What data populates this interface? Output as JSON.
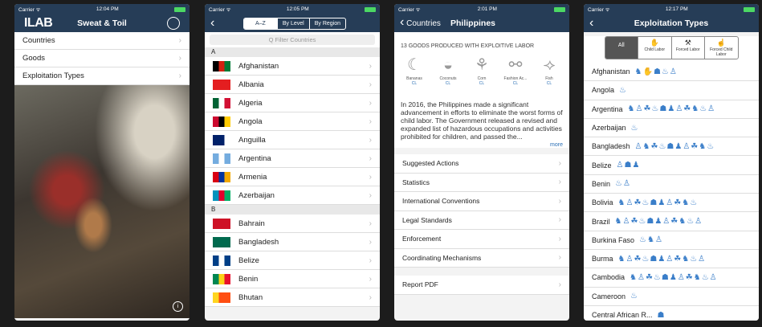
{
  "phone1": {
    "status": {
      "carrier": "Carrier ᯤ",
      "time": "12:04 PM"
    },
    "logo": "ILAB",
    "title": "Sweat & Toil",
    "menu": [
      {
        "label": "Countries"
      },
      {
        "label": "Goods"
      },
      {
        "label": "Exploitation Types"
      }
    ]
  },
  "phone2": {
    "status": {
      "carrier": "Carrier ᯤ",
      "time": "12:05 PM"
    },
    "segments": [
      "A–Z",
      "By Level",
      "By Region"
    ],
    "search_placeholder": "Q  Filter Countries",
    "section_a": "A",
    "section_b": "B",
    "countries_a": [
      {
        "name": "Afghanistan",
        "flag": [
          "#000000",
          "#d32011",
          "#007a36"
        ]
      },
      {
        "name": "Albania",
        "flag": [
          "#e41e20",
          "#e41e20",
          "#e41e20"
        ]
      },
      {
        "name": "Algeria",
        "flag": [
          "#006233",
          "#ffffff",
          "#d21034"
        ]
      },
      {
        "name": "Angola",
        "flag": [
          "#cc092f",
          "#000000",
          "#ffcb00"
        ]
      },
      {
        "name": "Anguilla",
        "flag": [
          "#012169",
          "#012169",
          "#ffffff"
        ]
      },
      {
        "name": "Argentina",
        "flag": [
          "#74acdf",
          "#ffffff",
          "#74acdf"
        ]
      },
      {
        "name": "Armenia",
        "flag": [
          "#d90012",
          "#0033a0",
          "#f2a800"
        ]
      },
      {
        "name": "Azerbaijan",
        "flag": [
          "#0092bc",
          "#e4002b",
          "#00af66"
        ]
      }
    ],
    "countries_b": [
      {
        "name": "Bahrain",
        "flag": [
          "#ce1126",
          "#ce1126",
          "#ce1126"
        ]
      },
      {
        "name": "Bangladesh",
        "flag": [
          "#006a4e",
          "#006a4e",
          "#006a4e"
        ]
      },
      {
        "name": "Belize",
        "flag": [
          "#003f87",
          "#ffffff",
          "#003f87"
        ]
      },
      {
        "name": "Benin",
        "flag": [
          "#008751",
          "#fcd116",
          "#e8112d"
        ]
      },
      {
        "name": "Bhutan",
        "flag": [
          "#ffd520",
          "#ff4e12",
          "#ff4e12"
        ]
      }
    ]
  },
  "phone3": {
    "status": {
      "carrier": "Carrier ᯤ",
      "time": "2:01 PM"
    },
    "back_label": "Countries",
    "title": "Philippines",
    "goods_title": "13 GOODS PRODUCED WITH EXPLOITIVE LABOR",
    "goods": [
      {
        "name": "Bananas",
        "tag": "CL",
        "icon": "banana-icon",
        "glyph": "☾"
      },
      {
        "name": "Coconuts",
        "tag": "CL",
        "icon": "coconut-icon",
        "glyph": "◒"
      },
      {
        "name": "Corn",
        "tag": "CL",
        "icon": "corn-icon",
        "glyph": "⚘"
      },
      {
        "name": "Fashion Ac...",
        "tag": "CL",
        "icon": "earrings-icon",
        "glyph": "⚯"
      },
      {
        "name": "Fish",
        "tag": "CL",
        "icon": "fish-icon",
        "glyph": "⟢"
      }
    ],
    "paragraph": "In 2016, the Philippines made a significant advancement in efforts to eliminate the worst forms of child labor. The Government released a revised and expanded list of hazardous occupations and activities prohibited for children, and passed the...",
    "more": "more",
    "sections": [
      {
        "label": "Suggested Actions"
      },
      {
        "label": "Statistics"
      },
      {
        "label": "International Conventions"
      },
      {
        "label": "Legal Standards"
      },
      {
        "label": "Enforcement"
      },
      {
        "label": "Coordinating Mechanisms"
      }
    ],
    "report": "Report PDF"
  },
  "phone4": {
    "status": {
      "carrier": "Carrier ᯤ",
      "time": "12:17 PM"
    },
    "title": "Exploitation Types",
    "filters": [
      {
        "label": "All",
        "icon": ""
      },
      {
        "label": "Child Labor",
        "icon": "✋"
      },
      {
        "label": "Forced Labor",
        "icon": "⚒"
      },
      {
        "label": "Forced Child Labor",
        "icon": "☝"
      }
    ],
    "rows": [
      {
        "country": "Afghanistan",
        "icons": "♞✋☗♨♙"
      },
      {
        "country": "Angola",
        "icons": "♨"
      },
      {
        "country": "Argentina",
        "icons": "♞♙☘♨☗♟♙☘♞♨♙"
      },
      {
        "country": "Azerbaijan",
        "icons": "♨"
      },
      {
        "country": "Bangladesh",
        "icons": "♙♞☘♨☗♟♙☘♞♨"
      },
      {
        "country": "Belize",
        "icons": "♙☗♟"
      },
      {
        "country": "Benin",
        "icons": "♨♙"
      },
      {
        "country": "Bolivia",
        "icons": "♞♙☘♨☗♟♙☘♞♨"
      },
      {
        "country": "Brazil",
        "icons": "♞♙☘♨☗♟♙☘♞♨♙"
      },
      {
        "country": "Burkina Faso",
        "icons": "♨♞♙"
      },
      {
        "country": "Burma",
        "icons": "♞♙☘♨☗♟♙☘♞♨♙"
      },
      {
        "country": "Cambodia",
        "icons": "♞♙☘♨☗♟♙☘♞♨♙"
      },
      {
        "country": "Cameroon",
        "icons": "♨"
      },
      {
        "country": "Central African R...",
        "icons": "☗"
      }
    ]
  }
}
